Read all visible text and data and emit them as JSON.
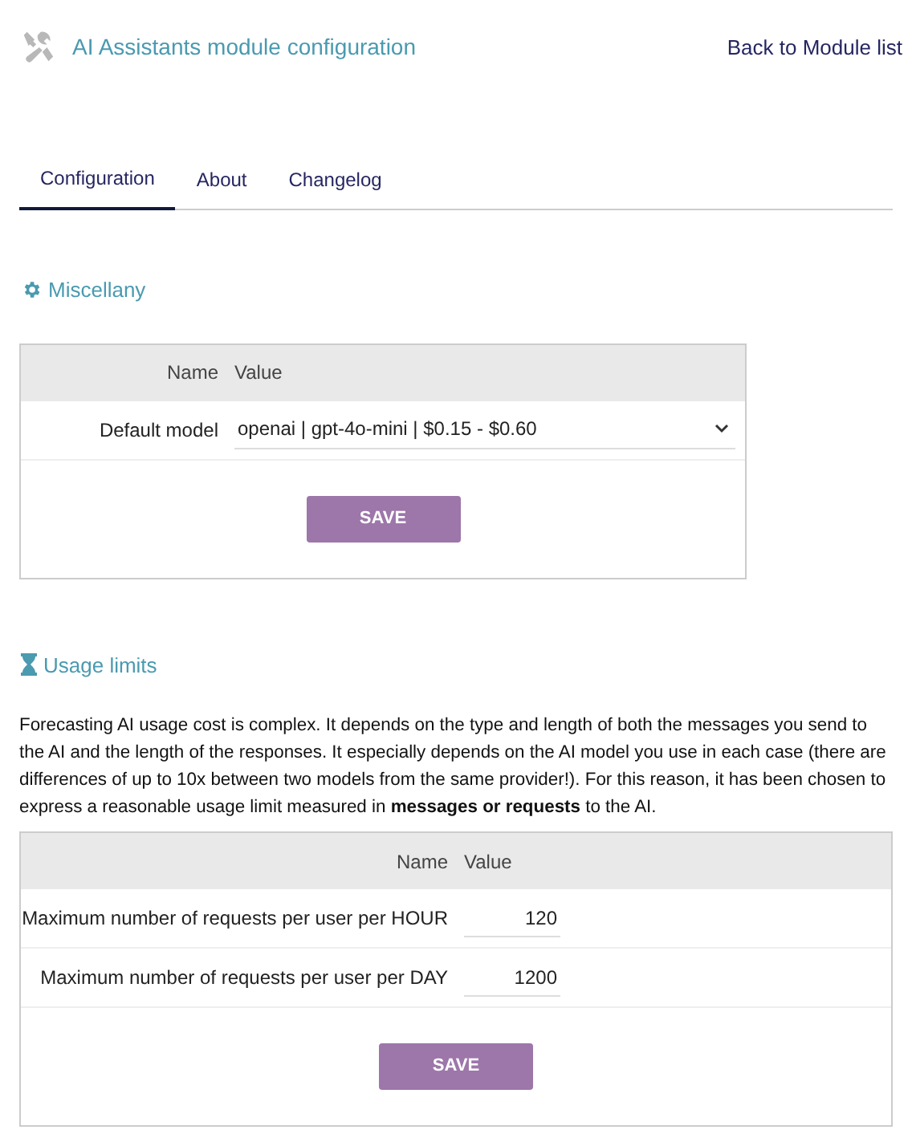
{
  "header": {
    "title": "AI Assistants module configuration",
    "back_link": "Back to Module list"
  },
  "tabs": [
    {
      "label": "Configuration",
      "selected": true
    },
    {
      "label": "About",
      "selected": false
    },
    {
      "label": "Changelog",
      "selected": false
    }
  ],
  "sections": [
    {
      "title": "Miscellany",
      "kind": "general",
      "table": {
        "columns": [
          "Name",
          "Value"
        ],
        "rows": [
          {
            "kind": "select",
            "name": "Default model",
            "value": "openai | gpt-4o-mini | $0.15 - $0.60"
          }
        ]
      },
      "button": "SAVE"
    },
    {
      "title": "Usage limits",
      "kind": "limits",
      "description": "Forecasting AI usage cost is complex. It depends on the type and length of both the messages you send to the AI and the length of the responses. It especially depends on the AI model you use in each case (there are differences of up to 10x between two models from the same provider!). For this reason, it has been chosen to express a reasonable usage limit measured in **messages or requests** to the AI.",
      "table": {
        "columns": [
          "Name",
          "Value"
        ],
        "rows": [
          {
            "kind": "number",
            "name": "Maximum number of requests per user per HOUR",
            "value": "120"
          },
          {
            "kind": "number",
            "name": "Maximum number of requests per user per DAY",
            "value": "1200"
          }
        ]
      },
      "button": "SAVE"
    }
  ]
}
